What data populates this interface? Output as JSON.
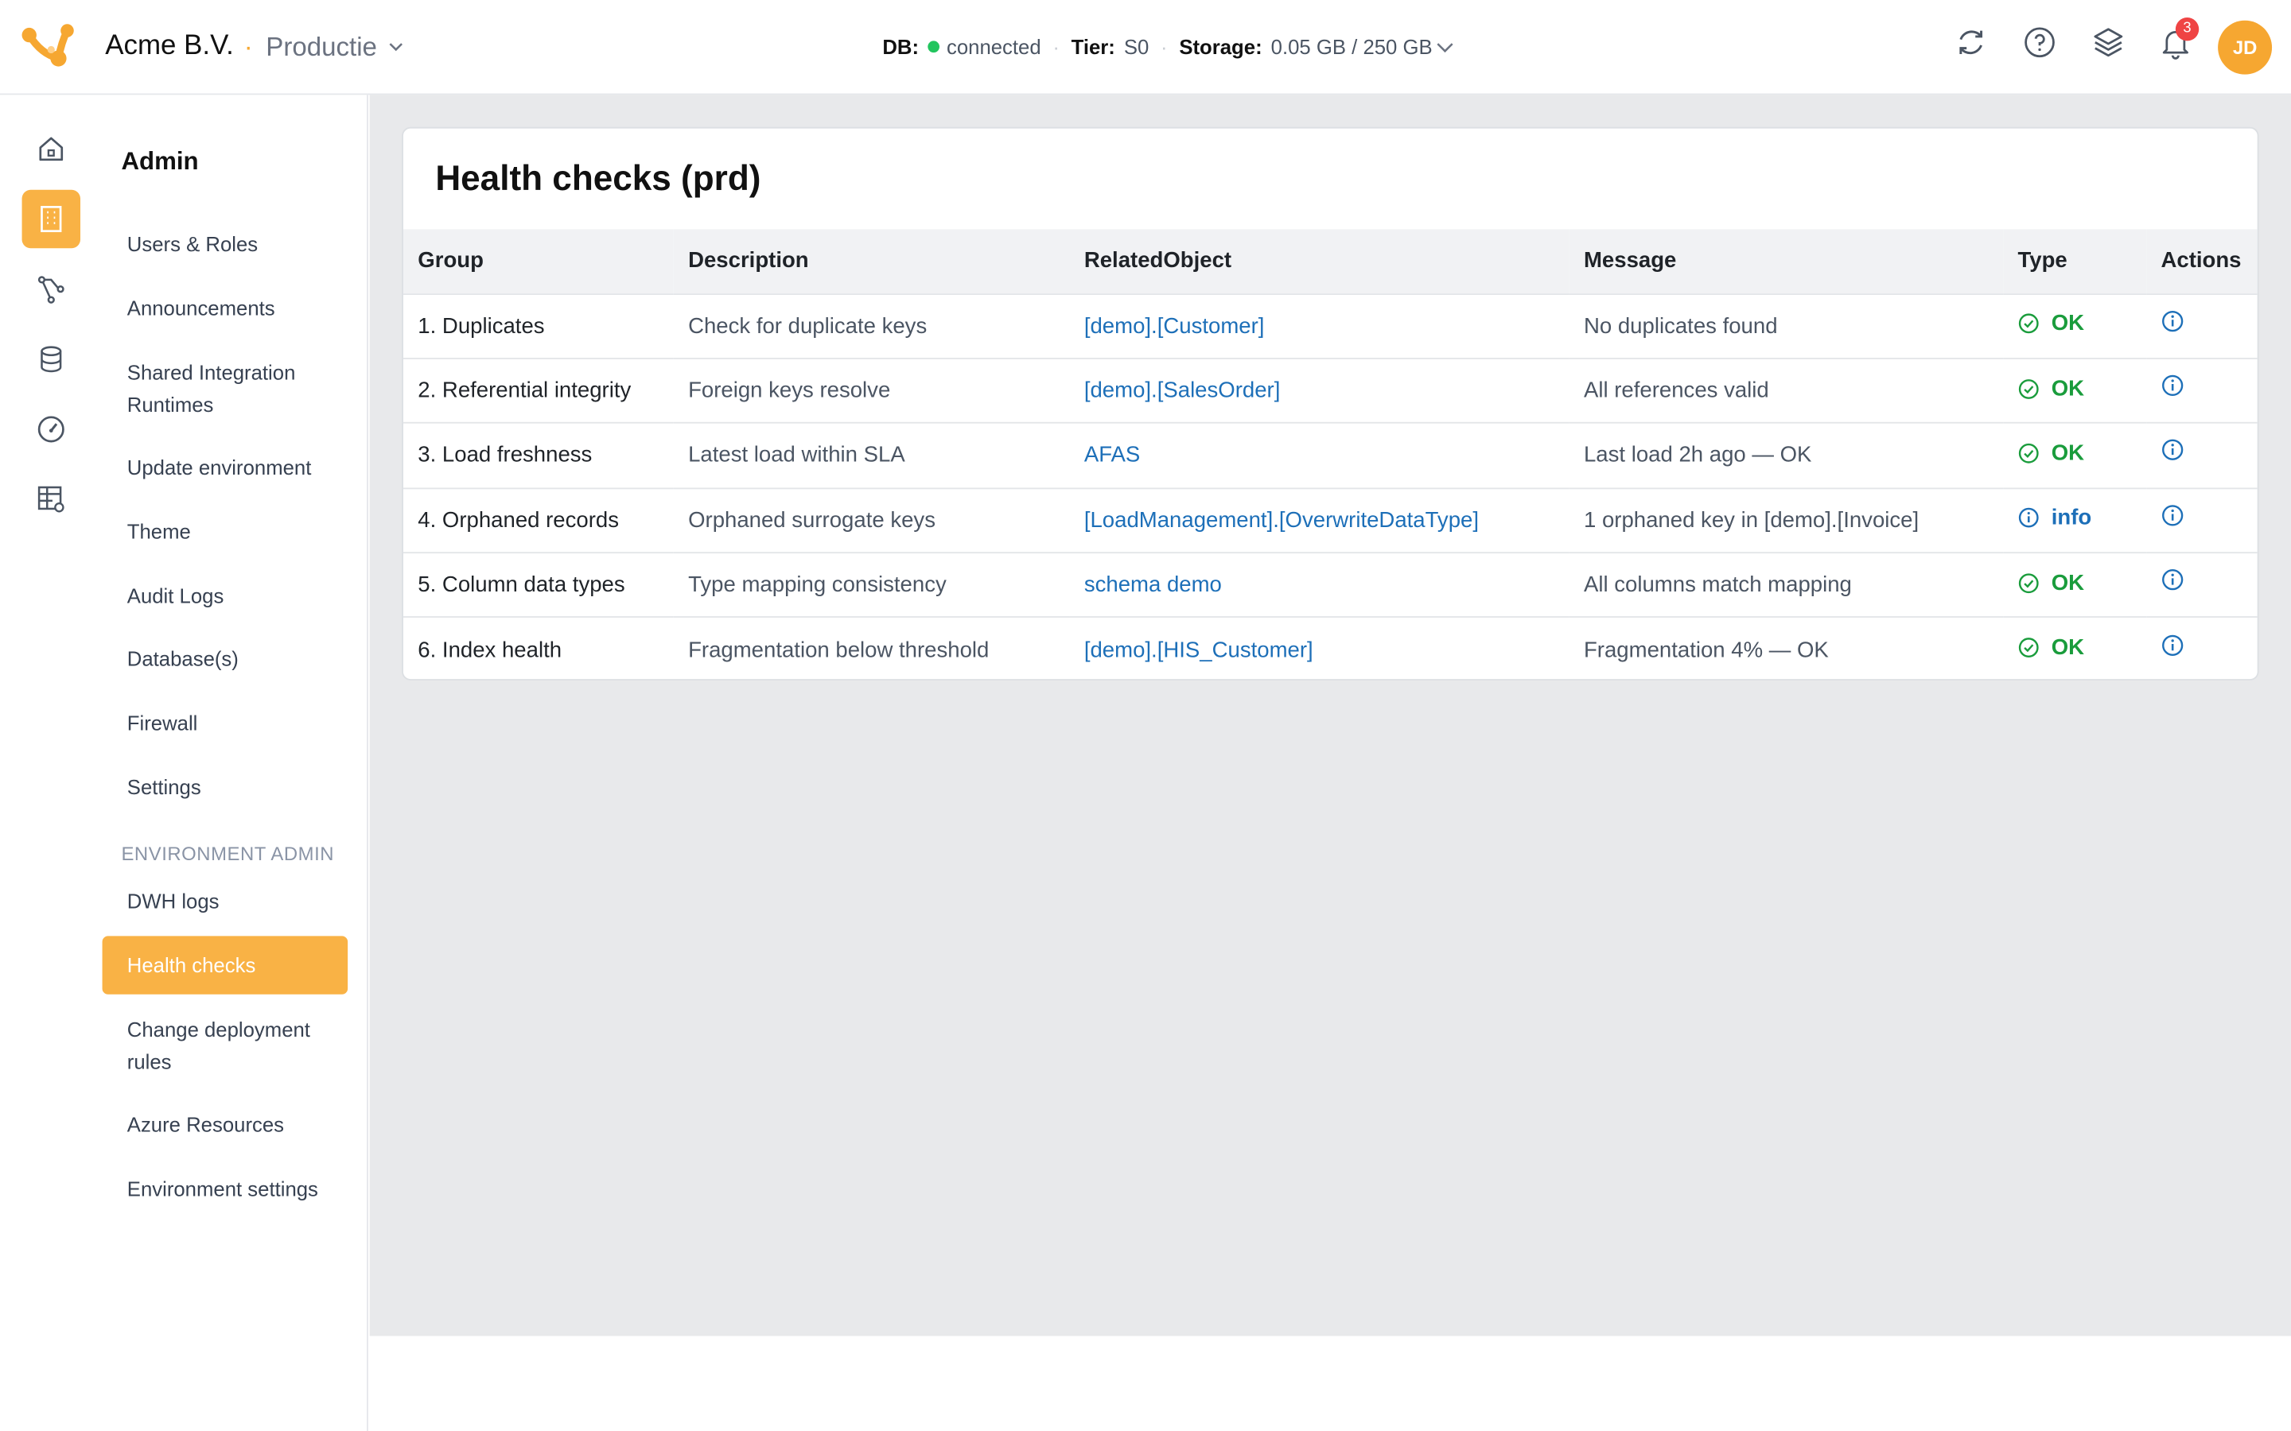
{
  "header": {
    "org_name": "Acme B.V.",
    "separator": "·",
    "environment": "Productie",
    "db_label": "DB:",
    "db_status": "connected",
    "tier_label": "Tier:",
    "tier_value": "S0",
    "storage_label": "Storage:",
    "storage_value": "0.05 GB / 250 GB",
    "notification_count": "3",
    "user_initials": "JD"
  },
  "rail": {
    "items": [
      {
        "name": "home-icon"
      },
      {
        "name": "admin-building-icon",
        "active": true
      },
      {
        "name": "pipeline-icon"
      },
      {
        "name": "database-icon"
      },
      {
        "name": "gauge-icon"
      },
      {
        "name": "table-settings-icon"
      }
    ]
  },
  "menu": {
    "title": "Admin",
    "items": [
      {
        "label": "Users & Roles"
      },
      {
        "label": "Announcements"
      },
      {
        "label": "Shared Integration Runtimes"
      },
      {
        "label": "Update environment"
      },
      {
        "label": "Theme"
      },
      {
        "label": "Audit Logs"
      },
      {
        "label": "Database(s)"
      },
      {
        "label": "Firewall"
      },
      {
        "label": "Settings"
      }
    ],
    "section_label": "ENVIRONMENT ADMIN",
    "env_items": [
      {
        "label": "DWH logs"
      },
      {
        "label": "Health checks",
        "active": true
      },
      {
        "label": "Change deployment rules"
      },
      {
        "label": "Azure Resources"
      },
      {
        "label": "Environment settings"
      }
    ]
  },
  "page": {
    "title": "Health checks (prd)",
    "columns": [
      "Group",
      "Description",
      "RelatedObject",
      "Message",
      "Type",
      "Actions"
    ],
    "rows": [
      {
        "group": "1. Duplicates",
        "description": "Check for duplicate keys",
        "related": "[demo].[Customer]",
        "message": "No duplicates found",
        "type": "OK"
      },
      {
        "group": "2. Referential integrity",
        "description": "Foreign keys resolve",
        "related": "[demo].[SalesOrder]",
        "message": "All references valid",
        "type": "OK"
      },
      {
        "group": "3. Load freshness",
        "description": "Latest load within SLA",
        "related": "AFAS",
        "message": "Last load 2h ago — OK",
        "type": "OK"
      },
      {
        "group": "4. Orphaned records",
        "description": "Orphaned surrogate keys",
        "related": "[LoadManagement].[OverwriteDataType]",
        "message": "1 orphaned key in [demo].[Invoice]",
        "type": "info"
      },
      {
        "group": "5. Column data types",
        "description": "Type mapping consistency",
        "related": "schema demo",
        "message": "All columns match mapping",
        "type": "OK"
      },
      {
        "group": "6. Index health",
        "description": "Fragmentation below threshold",
        "related": "[demo].[HIS_Customer]",
        "message": "Fragmentation 4% — OK",
        "type": "OK"
      }
    ]
  },
  "colors": {
    "accent": "#f9b245",
    "ok": "#1a9c3c",
    "link": "#1d6fb8",
    "connected": "#22c55e",
    "badge": "#ef4444"
  }
}
